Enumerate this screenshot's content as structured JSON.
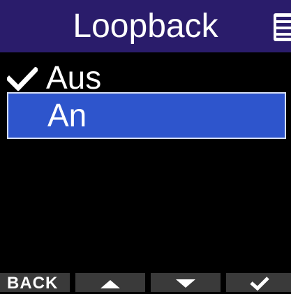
{
  "header": {
    "title": "Loopback",
    "battery_icon": "battery-icon"
  },
  "list": {
    "items": [
      {
        "label": "Aus",
        "checked": true,
        "selected": false
      },
      {
        "label": "An",
        "checked": false,
        "selected": true
      }
    ],
    "check_icon": "checkmark-icon"
  },
  "footer": {
    "back_label": "BACK",
    "up_icon": "up-arrow-icon",
    "down_icon": "down-arrow-icon",
    "confirm_icon": "checkmark-icon"
  },
  "colors": {
    "header_bg": "#2a1c6b",
    "selection_bg": "#2e55cc",
    "selection_border": "#d7dff5",
    "footer_button_bg": "#3a3a3a",
    "background": "#000000",
    "text": "#ffffff"
  }
}
